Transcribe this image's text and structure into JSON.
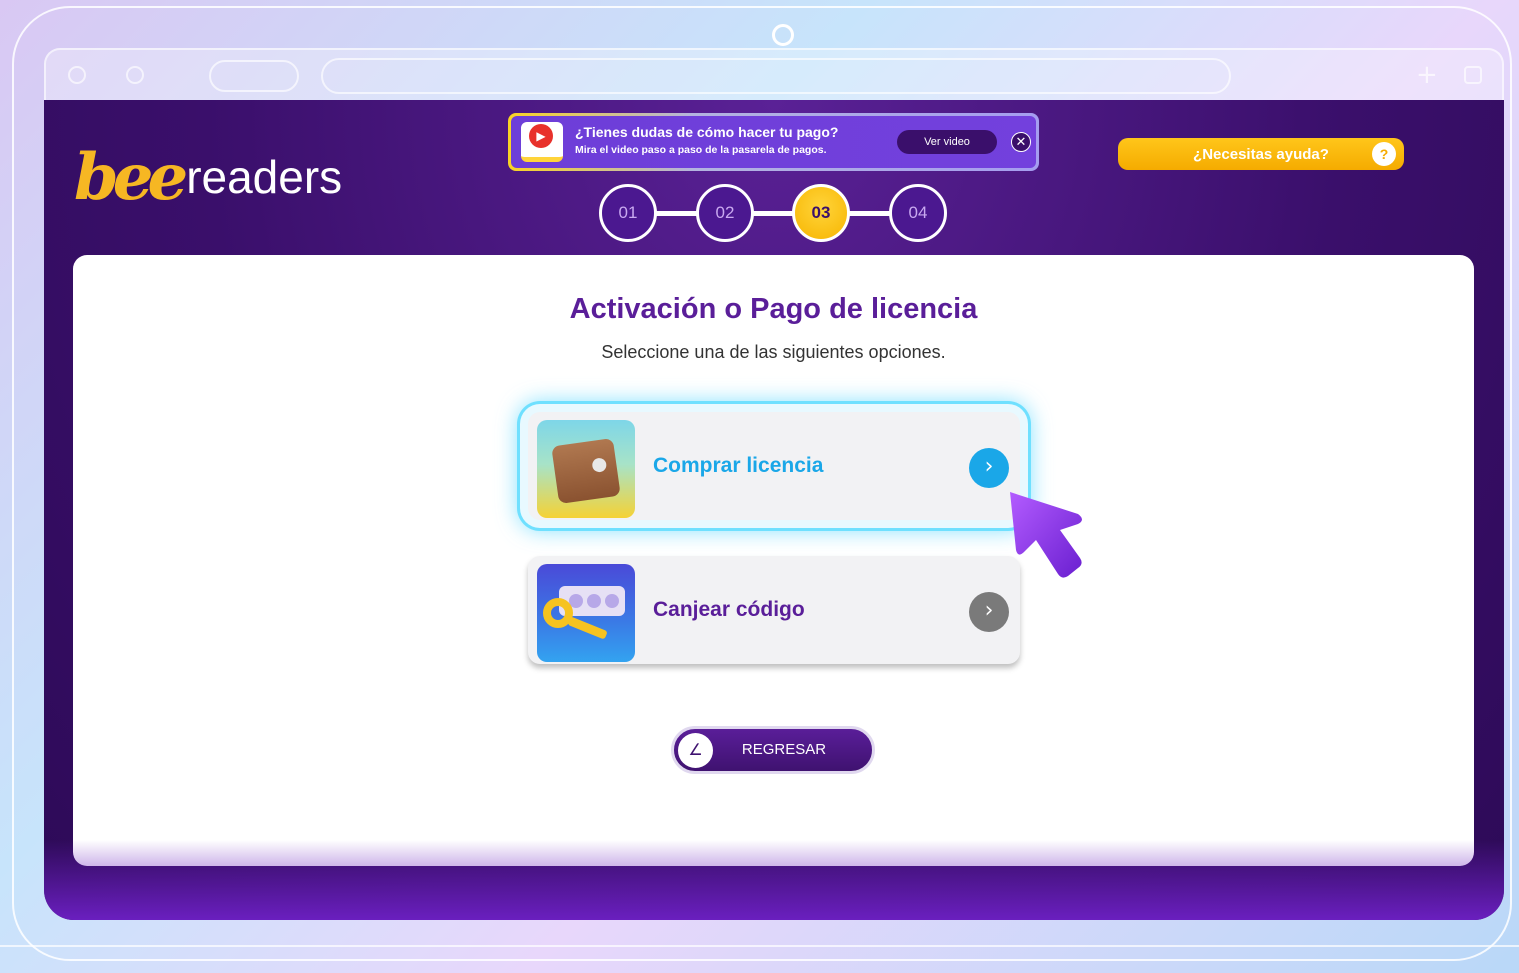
{
  "brand": {
    "logo_bee": "bee",
    "logo_readers": "readers"
  },
  "promo": {
    "title": "¿Tienes dudas de cómo hacer tu pago?",
    "subtitle": "Mira el video paso a paso de la pasarela de pagos.",
    "button_label": "Ver video",
    "close_glyph": "✕",
    "play_glyph": "▶"
  },
  "help": {
    "label": "¿Necesitas ayuda?",
    "icon_glyph": "?"
  },
  "stepper": {
    "steps": [
      "01",
      "02",
      "03",
      "04"
    ],
    "active_step": "03"
  },
  "main": {
    "title": "Activación o Pago de licencia",
    "subtitle": "Seleccione una de las siguientes opciones.",
    "options": [
      {
        "label": "Comprar licencia",
        "icon": "wallet-icon",
        "arrow_glyph": "›",
        "color": "#1aa7e8",
        "highlighted": true
      },
      {
        "label": "Canjear código",
        "icon": "key-icon",
        "arrow_glyph": "›",
        "color": "#5a1e99",
        "highlighted": false
      }
    ],
    "back_button": {
      "label": "REGRESAR",
      "icon_glyph": "∠"
    }
  },
  "colors": {
    "primary_purple": "#5a1e99",
    "accent_yellow": "#f5ab00",
    "accent_blue": "#1aa7e8",
    "neutral_arrow": "#7a7a7a"
  }
}
